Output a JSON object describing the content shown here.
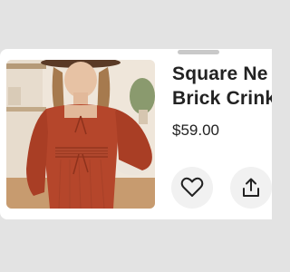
{
  "product": {
    "title_line_1": "Square Ne",
    "title_line_2": "Brick Crink",
    "price": "$59.00",
    "image_alt": "Model wearing brick red crinkle square neck dress with hat"
  },
  "actions": {
    "favorite_icon": "heart-outline-icon",
    "share_icon": "share-upload-icon"
  },
  "colors": {
    "dress": "#b5462b",
    "background": "#e3e3e3",
    "card": "#ffffff",
    "button": "#f1f1f1"
  }
}
